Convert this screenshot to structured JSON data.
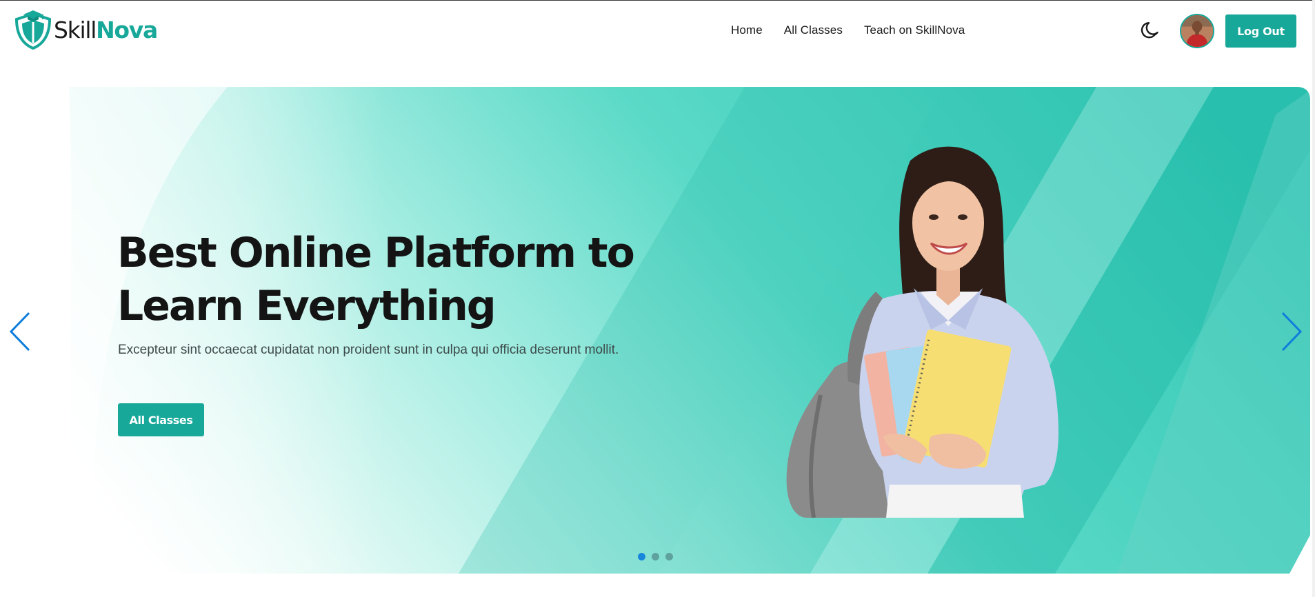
{
  "brand": {
    "name_part1": "Skill",
    "name_part2": "Nova",
    "primary_color": "#17a89a",
    "logo_icon": "shield-graduation-cap-logo"
  },
  "nav": {
    "links": [
      "Home",
      "All Classes",
      "Teach on SkillNova"
    ],
    "theme_toggle_icon": "moon-icon",
    "avatar_icon": "user-avatar",
    "logout_label": "Log Out"
  },
  "hero": {
    "title": "Best Online Platform to Learn Everything",
    "subtitle": "Excepteur sint occaecat cupidatat non proident sunt in culpa qui officia deserunt mollit.",
    "cta_label": "All Classes",
    "image_subject": "smiling student holding notebooks with backpack",
    "prev_icon": "chevron-left-icon",
    "next_icon": "chevron-right-icon",
    "slide_count": 3,
    "active_slide": 1
  }
}
